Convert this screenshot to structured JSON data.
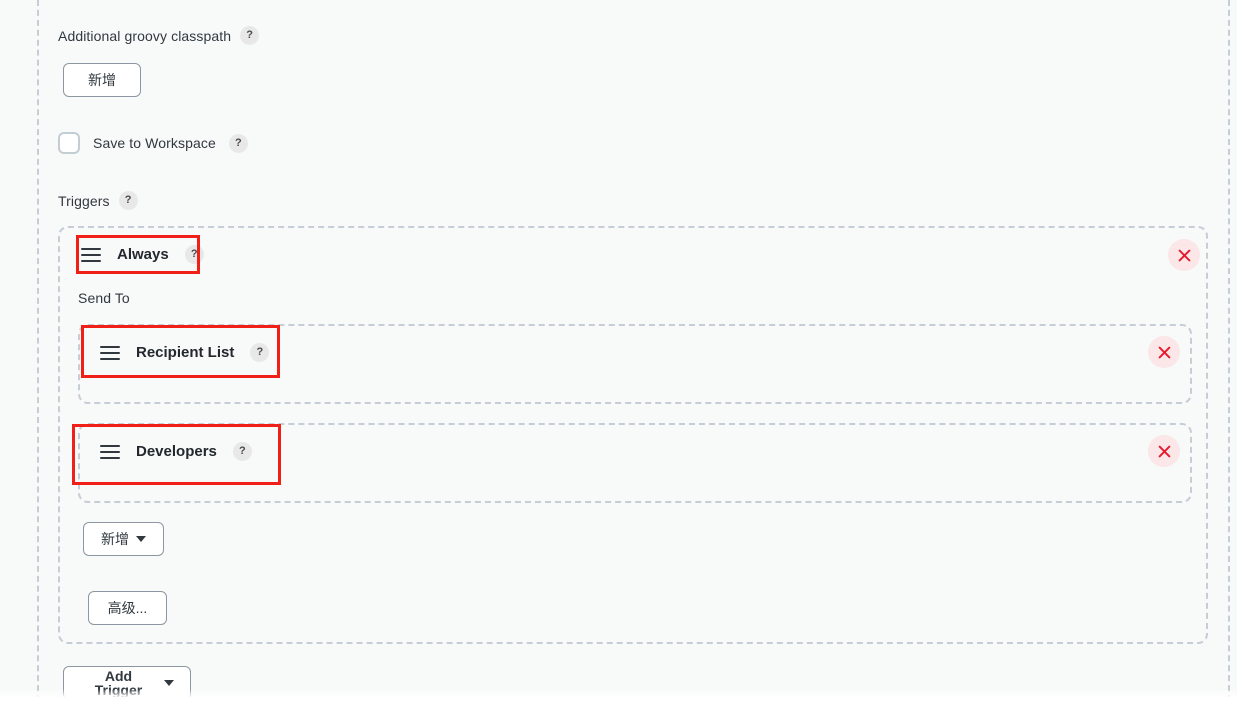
{
  "page": {
    "background_color": "#f8f9f9",
    "divider_color": "#c5ced6",
    "highlight_color": "#f02019",
    "delete_color": "#e8192c",
    "delete_bg_color": "#fbe6e8"
  },
  "classpath_section": {
    "label": "Additional groovy classpath",
    "help": "?",
    "add_button": "新增"
  },
  "save_workspace": {
    "label": "Save to Workspace",
    "help": "?",
    "checked": false
  },
  "triggers_section": {
    "label": "Triggers",
    "help": "?",
    "trigger": {
      "icon": "drag-handle-icon",
      "title": "Always",
      "help": "?",
      "delete_label": "×",
      "send_to_label": "Send To",
      "recipients": [
        {
          "icon": "drag-handle-icon",
          "title": "Recipient List",
          "help": "?",
          "delete_label": "×"
        },
        {
          "icon": "drag-handle-icon",
          "title": "Developers",
          "help": "?",
          "delete_label": "×"
        }
      ],
      "add_recipient_button": "新增",
      "advanced_button": "高级..."
    },
    "add_trigger_button": "Add Trigger"
  }
}
